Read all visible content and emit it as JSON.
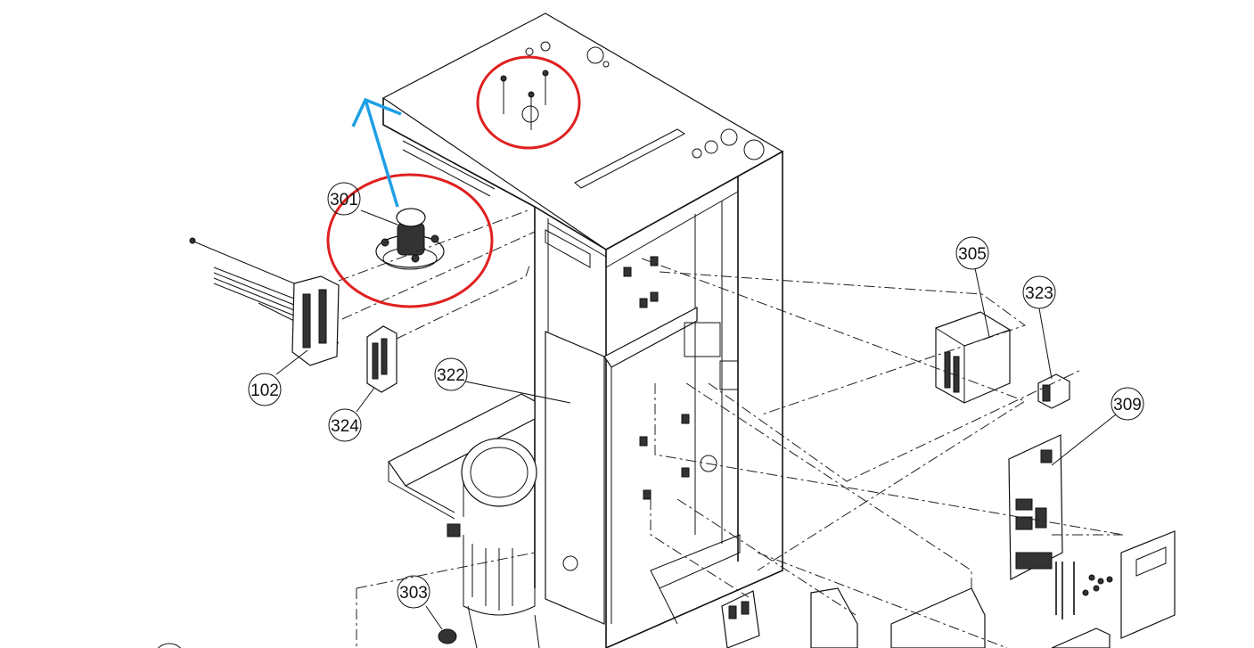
{
  "diagram": {
    "callouts": [
      "301",
      "102",
      "324",
      "322",
      "305",
      "323",
      "309",
      "303"
    ],
    "highlight_color": "#e02020",
    "arrow_color": "#1ea0e6",
    "line_color": "#111111"
  }
}
